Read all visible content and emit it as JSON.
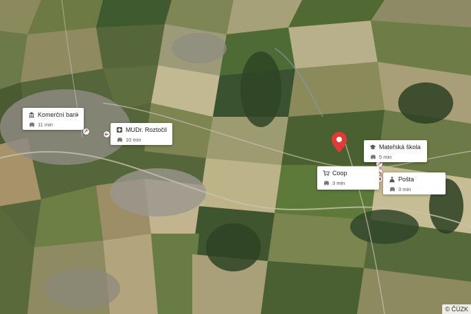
{
  "map": {
    "type": "satellite",
    "copyright": "© ČÚZK",
    "accent_color": "#e53935"
  },
  "places": [
    {
      "name": "Komerční banka",
      "icon": "bank-icon",
      "travel_icon": "car-icon",
      "time": "11 min"
    },
    {
      "name": "MUDr. Roztočil Ja...",
      "icon": "medical-icon",
      "travel_icon": "car-icon",
      "time": "10 min"
    },
    {
      "name": "Mateřská škola Z...",
      "icon": "school-icon",
      "travel_icon": "car-icon",
      "time": "5 min"
    },
    {
      "name": "Coop",
      "icon": "shopping-cart-icon",
      "travel_icon": "car-icon",
      "time": "3 min"
    },
    {
      "name": "Pošta",
      "icon": "post-office-icon",
      "travel_icon": "car-icon",
      "time": "3 min"
    }
  ]
}
